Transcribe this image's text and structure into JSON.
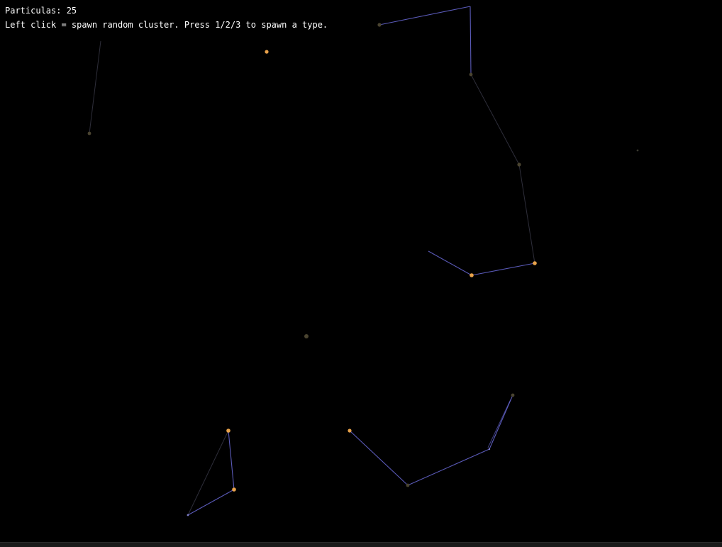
{
  "hud": {
    "particle_count_label": "Particulas: 25",
    "help_text": "Left click = spawn random cluster. Press 1/2/3 to spawn a type."
  },
  "colors": {
    "background": "#000000",
    "hud_text": "#ffffff",
    "particle_orange": "#e8a24a",
    "particle_dim": "#4a4430",
    "link_blue": "#6a6ad8",
    "link_dim": "#3a3a48"
  }
}
